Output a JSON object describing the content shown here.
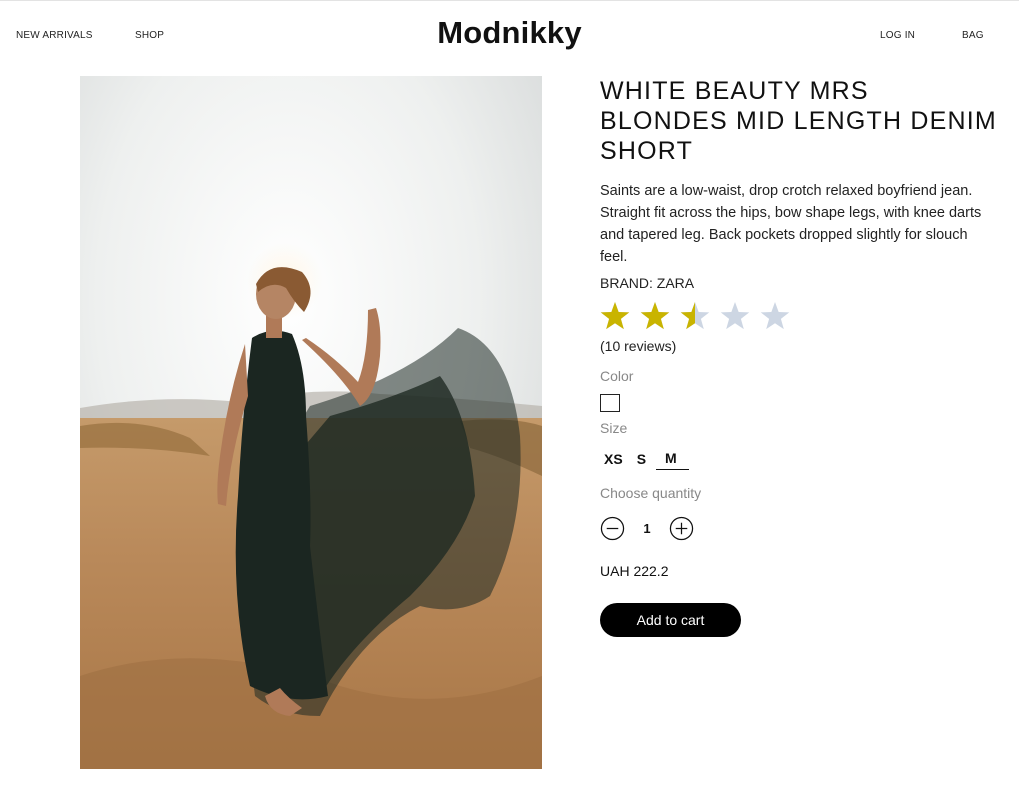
{
  "header": {
    "logo": "Modnikky",
    "nav_left": [
      "NEW ARRIVALS",
      "SHOP"
    ],
    "nav_right": [
      "LOG IN",
      "BAG"
    ]
  },
  "product": {
    "title": "WHITE BEAUTY MRS BLONDES MID LENGTH DENIM SHORT",
    "description": "Saints are a low-waist, drop crotch relaxed boyfriend jean. Straight fit across the hips, bow shape legs, with knee darts and tapered leg. Back pockets dropped slightly for slouch feel.",
    "brand": "BRAND: ZARA",
    "rating": 2.5,
    "rating_max": 5,
    "reviews": "(10 reviews)",
    "color_label": "Color",
    "size_label": "Size",
    "sizes": [
      "XS",
      "S",
      "M"
    ],
    "selected_size": "M",
    "quantity_label": "Choose quantity",
    "quantity": "1",
    "price": "UAH 222.2",
    "add_to_cart": "Add to cart"
  },
  "colors": {
    "star_filled": "#c9b400",
    "star_empty": "#cdd6e3",
    "button_bg": "#000000"
  }
}
